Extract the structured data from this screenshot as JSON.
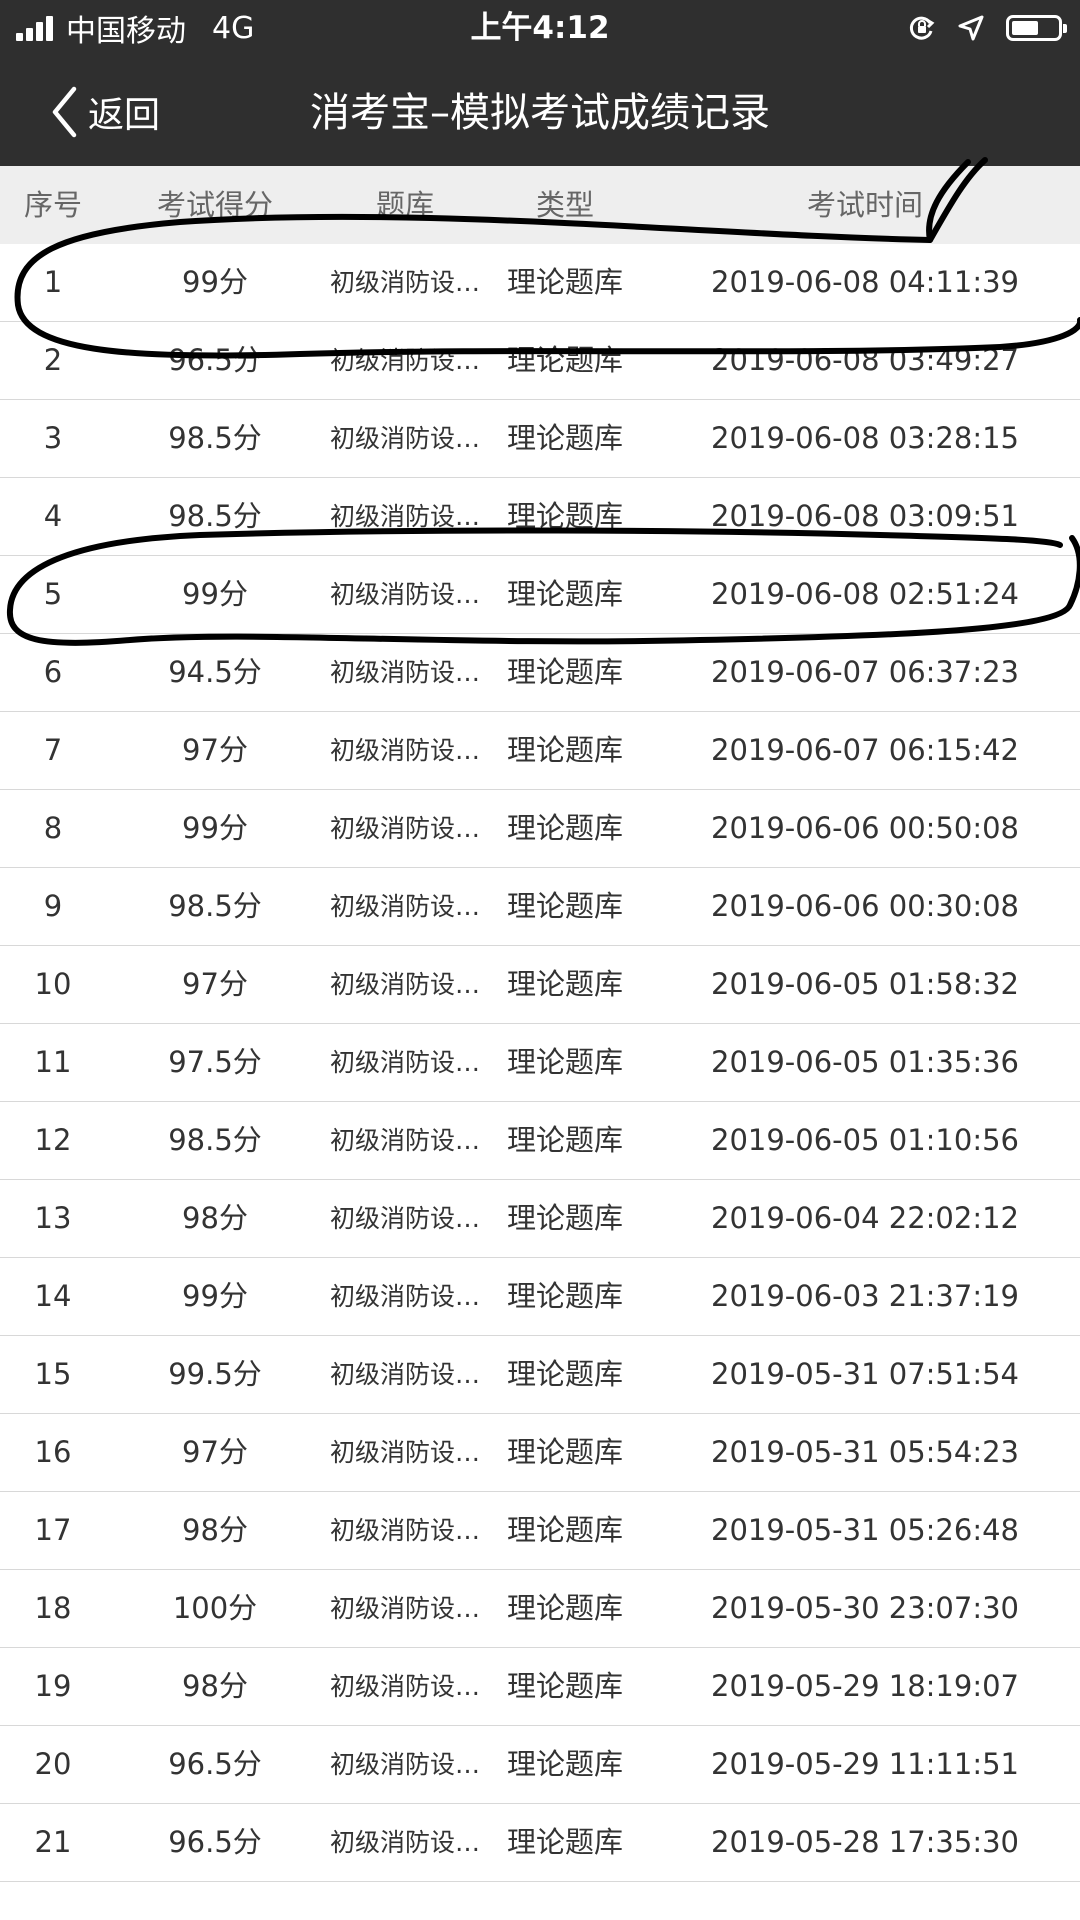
{
  "status": {
    "carrier": "中国移动",
    "network": "4G",
    "time": "上午4:12",
    "battery_level": 0.6
  },
  "nav": {
    "back_label": "返回",
    "title": "消考宝–模拟考试成绩记录"
  },
  "headers": {
    "index": "序号",
    "score": "考试得分",
    "bank": "题库",
    "type": "类型",
    "time": "考试时间"
  },
  "rows": [
    {
      "index": "1",
      "score": "99分",
      "bank": "初级消防设…",
      "type": "理论题库",
      "time": "2019-06-08 04:11:39"
    },
    {
      "index": "2",
      "score": "96.5分",
      "bank": "初级消防设…",
      "type": "理论题库",
      "time": "2019-06-08 03:49:27"
    },
    {
      "index": "3",
      "score": "98.5分",
      "bank": "初级消防设…",
      "type": "理论题库",
      "time": "2019-06-08 03:28:15"
    },
    {
      "index": "4",
      "score": "98.5分",
      "bank": "初级消防设…",
      "type": "理论题库",
      "time": "2019-06-08 03:09:51"
    },
    {
      "index": "5",
      "score": "99分",
      "bank": "初级消防设…",
      "type": "理论题库",
      "time": "2019-06-08 02:51:24"
    },
    {
      "index": "6",
      "score": "94.5分",
      "bank": "初级消防设…",
      "type": "理论题库",
      "time": "2019-06-07 06:37:23"
    },
    {
      "index": "7",
      "score": "97分",
      "bank": "初级消防设…",
      "type": "理论题库",
      "time": "2019-06-07 06:15:42"
    },
    {
      "index": "8",
      "score": "99分",
      "bank": "初级消防设…",
      "type": "理论题库",
      "time": "2019-06-06 00:50:08"
    },
    {
      "index": "9",
      "score": "98.5分",
      "bank": "初级消防设…",
      "type": "理论题库",
      "time": "2019-06-06 00:30:08"
    },
    {
      "index": "10",
      "score": "97分",
      "bank": "初级消防设…",
      "type": "理论题库",
      "time": "2019-06-05 01:58:32"
    },
    {
      "index": "11",
      "score": "97.5分",
      "bank": "初级消防设…",
      "type": "理论题库",
      "time": "2019-06-05 01:35:36"
    },
    {
      "index": "12",
      "score": "98.5分",
      "bank": "初级消防设…",
      "type": "理论题库",
      "time": "2019-06-05 01:10:56"
    },
    {
      "index": "13",
      "score": "98分",
      "bank": "初级消防设…",
      "type": "理论题库",
      "time": "2019-06-04 22:02:12"
    },
    {
      "index": "14",
      "score": "99分",
      "bank": "初级消防设…",
      "type": "理论题库",
      "time": "2019-06-03 21:37:19"
    },
    {
      "index": "15",
      "score": "99.5分",
      "bank": "初级消防设…",
      "type": "理论题库",
      "time": "2019-05-31 07:51:54"
    },
    {
      "index": "16",
      "score": "97分",
      "bank": "初级消防设…",
      "type": "理论题库",
      "time": "2019-05-31 05:54:23"
    },
    {
      "index": "17",
      "score": "98分",
      "bank": "初级消防设…",
      "type": "理论题库",
      "time": "2019-05-31 05:26:48"
    },
    {
      "index": "18",
      "score": "100分",
      "bank": "初级消防设…",
      "type": "理论题库",
      "time": "2019-05-30 23:07:30"
    },
    {
      "index": "19",
      "score": "98分",
      "bank": "初级消防设…",
      "type": "理论题库",
      "time": "2019-05-29 18:19:07"
    },
    {
      "index": "20",
      "score": "96.5分",
      "bank": "初级消防设…",
      "type": "理论题库",
      "time": "2019-05-29 11:11:51"
    },
    {
      "index": "21",
      "score": "96.5分",
      "bank": "初级消防设…",
      "type": "理论题库",
      "time": "2019-05-28 17:35:30"
    }
  ]
}
